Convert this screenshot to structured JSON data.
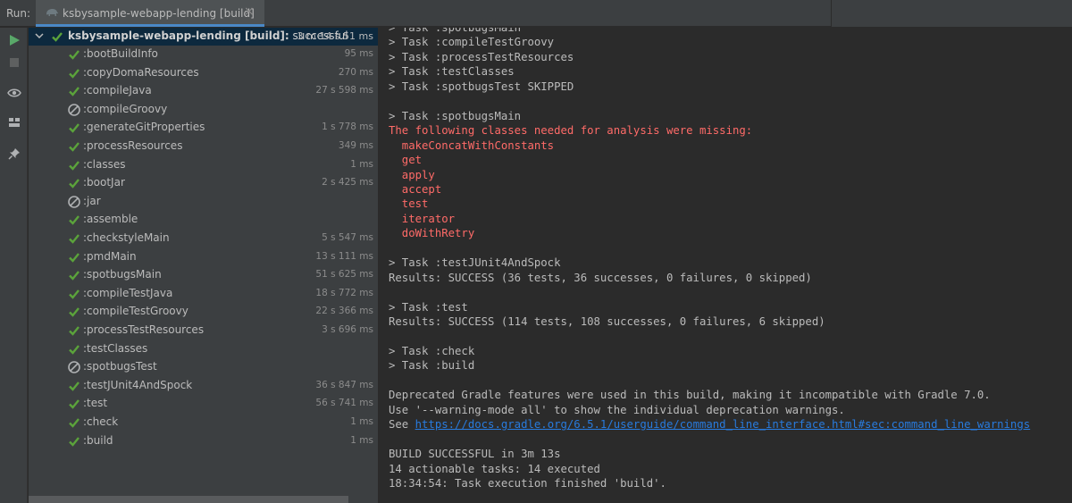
{
  "header": {
    "run_label": "Run:",
    "tab_label": "ksbysample-webapp-lending [build]",
    "tab_close": "×"
  },
  "colors": {
    "success": "#5ba33b",
    "skipped": "#8c8c8c",
    "error_text": "#ff6b68",
    "link": "#287bde",
    "run_green": "#59a869"
  },
  "toolbar": {
    "buttons": [
      "run-icon",
      "stop-icon",
      "eye-icon",
      "layout-icon",
      "pin-icon"
    ]
  },
  "tree": {
    "root": {
      "name_bold": "ksbysample-webapp-lending [build]:",
      "name_rest": " successful",
      "time": "3 m 14 s 51 ms"
    },
    "tasks": [
      {
        "name": ":bootBuildInfo",
        "time": "95 ms",
        "status": "success"
      },
      {
        "name": ":copyDomaResources",
        "time": "270 ms",
        "status": "success"
      },
      {
        "name": ":compileJava",
        "time": "27 s 598 ms",
        "status": "success"
      },
      {
        "name": ":compileGroovy",
        "time": "",
        "status": "skipped"
      },
      {
        "name": ":generateGitProperties",
        "time": "1 s 778 ms",
        "status": "success"
      },
      {
        "name": ":processResources",
        "time": "349 ms",
        "status": "success"
      },
      {
        "name": ":classes",
        "time": "1 ms",
        "status": "success"
      },
      {
        "name": ":bootJar",
        "time": "2 s 425 ms",
        "status": "success"
      },
      {
        "name": ":jar",
        "time": "",
        "status": "skipped"
      },
      {
        "name": ":assemble",
        "time": "",
        "status": "success"
      },
      {
        "name": ":checkstyleMain",
        "time": "5 s 547 ms",
        "status": "success"
      },
      {
        "name": ":pmdMain",
        "time": "13 s 111 ms",
        "status": "success"
      },
      {
        "name": ":spotbugsMain",
        "time": "51 s 625 ms",
        "status": "success"
      },
      {
        "name": ":compileTestJava",
        "time": "18 s 772 ms",
        "status": "success"
      },
      {
        "name": ":compileTestGroovy",
        "time": "22 s 366 ms",
        "status": "success"
      },
      {
        "name": ":processTestResources",
        "time": "3 s 696 ms",
        "status": "success"
      },
      {
        "name": ":testClasses",
        "time": "",
        "status": "success"
      },
      {
        "name": ":spotbugsTest",
        "time": "",
        "status": "skipped"
      },
      {
        "name": ":testJUnit4AndSpock",
        "time": "36 s 847 ms",
        "status": "success"
      },
      {
        "name": ":test",
        "time": "56 s 741 ms",
        "status": "success"
      },
      {
        "name": ":check",
        "time": "1 ms",
        "status": "success"
      },
      {
        "name": ":build",
        "time": "1 ms",
        "status": "success"
      }
    ]
  },
  "console": {
    "lines": [
      {
        "text": "> Task :spotbugsMain",
        "type": "normal"
      },
      {
        "text": "> Task :compileTestGroovy",
        "type": "normal"
      },
      {
        "text": "> Task :processTestResources",
        "type": "normal"
      },
      {
        "text": "> Task :testClasses",
        "type": "normal"
      },
      {
        "text": "> Task :spotbugsTest SKIPPED",
        "type": "normal"
      },
      {
        "text": "",
        "type": "normal"
      },
      {
        "text": "> Task :spotbugsMain",
        "type": "normal"
      },
      {
        "text": "The following classes needed for analysis were missing:",
        "type": "err"
      },
      {
        "text": "  makeConcatWithConstants",
        "type": "err"
      },
      {
        "text": "  get",
        "type": "err"
      },
      {
        "text": "  apply",
        "type": "err"
      },
      {
        "text": "  accept",
        "type": "err"
      },
      {
        "text": "  test",
        "type": "err"
      },
      {
        "text": "  iterator",
        "type": "err"
      },
      {
        "text": "  doWithRetry",
        "type": "err"
      },
      {
        "text": "",
        "type": "normal"
      },
      {
        "text": "> Task :testJUnit4AndSpock",
        "type": "normal"
      },
      {
        "text": "Results: SUCCESS (36 tests, 36 successes, 0 failures, 0 skipped)",
        "type": "normal"
      },
      {
        "text": "",
        "type": "normal"
      },
      {
        "text": "> Task :test",
        "type": "normal"
      },
      {
        "text": "Results: SUCCESS (114 tests, 108 successes, 0 failures, 6 skipped)",
        "type": "normal"
      },
      {
        "text": "",
        "type": "normal"
      },
      {
        "text": "> Task :check",
        "type": "normal"
      },
      {
        "text": "> Task :build",
        "type": "normal"
      },
      {
        "text": "",
        "type": "normal"
      },
      {
        "text": "Deprecated Gradle features were used in this build, making it incompatible with Gradle 7.0.",
        "type": "normal"
      },
      {
        "text": "Use '--warning-mode all' to show the individual deprecation warnings.",
        "type": "normal"
      },
      {
        "text": "See ",
        "type": "link",
        "link": "https://docs.gradle.org/6.5.1/userguide/command_line_interface.html#sec:command_line_warnings"
      },
      {
        "text": "",
        "type": "normal"
      },
      {
        "text": "BUILD SUCCESSFUL in 3m 13s",
        "type": "normal"
      },
      {
        "text": "14 actionable tasks: 14 executed",
        "type": "normal"
      },
      {
        "text": "18:34:54: Task execution finished 'build'.",
        "type": "normal"
      }
    ]
  }
}
